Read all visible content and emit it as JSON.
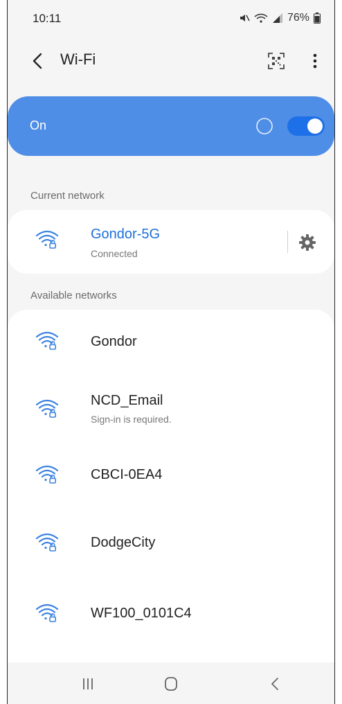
{
  "status_bar": {
    "time": "10:11",
    "battery": "76%"
  },
  "header": {
    "title": "Wi-Fi"
  },
  "toggle_bar": {
    "label": "On",
    "state": "on",
    "accent_color": "#4f8ee6"
  },
  "current_network": {
    "section_label": "Current network",
    "name": "Gondor-5G",
    "status": "Connected"
  },
  "available_networks": {
    "section_label": "Available networks",
    "items": [
      {
        "name": "Gondor",
        "sub": ""
      },
      {
        "name": "NCD_Email",
        "sub": "Sign-in is required."
      },
      {
        "name": "CBCI-0EA4",
        "sub": ""
      },
      {
        "name": "DodgeCity",
        "sub": ""
      },
      {
        "name": "WF100_0101C4",
        "sub": ""
      }
    ]
  },
  "icons": {
    "wifi": "wifi-lock-icon",
    "settings": "gear-icon",
    "back": "chevron-left-icon",
    "qr": "qr-scan-icon",
    "more": "more-vertical-icon"
  }
}
